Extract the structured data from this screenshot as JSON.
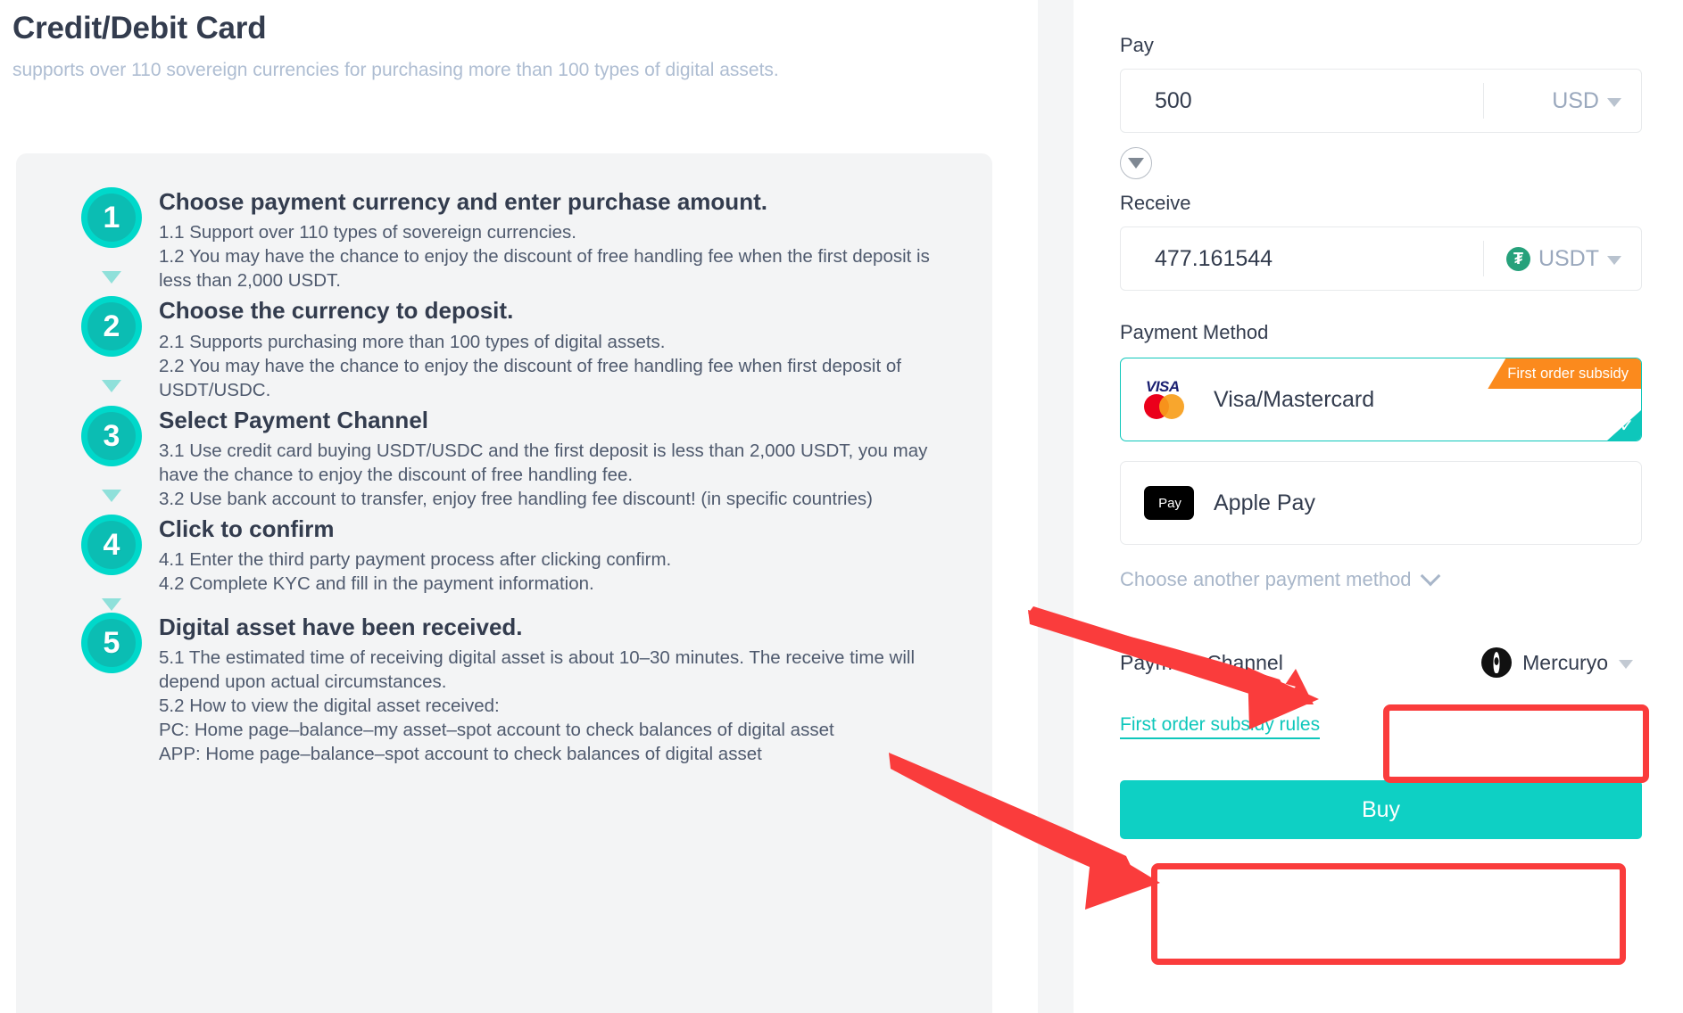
{
  "header": {
    "title": "Credit/Debit Card",
    "subtitle": "supports over 110 sovereign currencies for purchasing more than 100 types of digital assets."
  },
  "steps": [
    {
      "number": "1",
      "heading": "Choose payment currency and enter purchase amount.",
      "lines": [
        "1.1 Support over 110 types of sovereign currencies.",
        "1.2 You may have the chance to enjoy the discount of free handling fee when the first deposit is less than 2,000 USDT."
      ]
    },
    {
      "number": "2",
      "heading": "Choose the currency to deposit.",
      "lines": [
        "2.1 Supports purchasing more than 100 types of digital assets.",
        "2.2 You may have the chance to enjoy the discount of free handling fee when first deposit of USDT/USDC."
      ]
    },
    {
      "number": "3",
      "heading": "Select Payment Channel",
      "lines": [
        "3.1 Use credit card buying USDT/USDC and the first deposit is less than 2,000 USDT, you may have the chance to enjoy the discount of free handling fee.",
        "3.2 Use bank account to transfer, enjoy free handling fee discount! (in specific countries)"
      ]
    },
    {
      "number": "4",
      "heading": "Click to confirm",
      "lines": [
        "4.1 Enter the third party payment process after clicking confirm.",
        "4.2 Complete KYC and fill in the payment information."
      ]
    },
    {
      "number": "5",
      "heading": "Digital asset have been received.",
      "lines": [
        "5.1 The estimated time of receiving digital asset is about 10–30 minutes. The receive time will depend upon actual circumstances.",
        "5.2 How to view the digital asset received:",
        "PC: Home page–balance–my asset–spot account to check balances of digital asset",
        "APP: Home page–balance–spot account to check balances of digital asset"
      ]
    }
  ],
  "form": {
    "pay_label": "Pay",
    "pay_amount": "500",
    "pay_currency": "USD",
    "swap_icon": "circle-down-triangle-icon",
    "receive_label": "Receive",
    "receive_amount": "477.161544",
    "receive_currency": "USDT",
    "receive_currency_icon": "tether-icon",
    "receive_currency_glyph": "₮",
    "payment_method_label": "Payment Method",
    "methods": [
      {
        "name": "Visa/Mastercard",
        "icon": "visa-mastercard-icon",
        "badge": "First order subsidy",
        "selected": true,
        "check_glyph": "✓"
      },
      {
        "name": "Apple Pay",
        "icon": "apple-pay-icon",
        "apple_glyph": "",
        "pay_text": "Pay",
        "badge": "",
        "selected": false
      }
    ],
    "another_method_label": "Choose another payment method",
    "another_method_icon": "chevron-down-icon",
    "channel_label": "Payment Channel",
    "channel_value": "Mercuryo",
    "channel_icon": "mercuryo-logo-icon",
    "rules_link": "First order subsidy rules",
    "buy_label": "Buy"
  },
  "colors": {
    "accent_teal": "#0ec7bb",
    "badge_orange": "#fb8a1d",
    "annotation_red": "#fa3c3c",
    "title_navy": "#333c4e",
    "muted_blue": "#aebdd2"
  },
  "annotations": {
    "highlight_channel": "payment-channel-highlight",
    "highlight_buy": "buy-button-highlight",
    "arrow_to_channel": "red-arrow-icon",
    "arrow_to_buy": "red-arrow-icon"
  }
}
